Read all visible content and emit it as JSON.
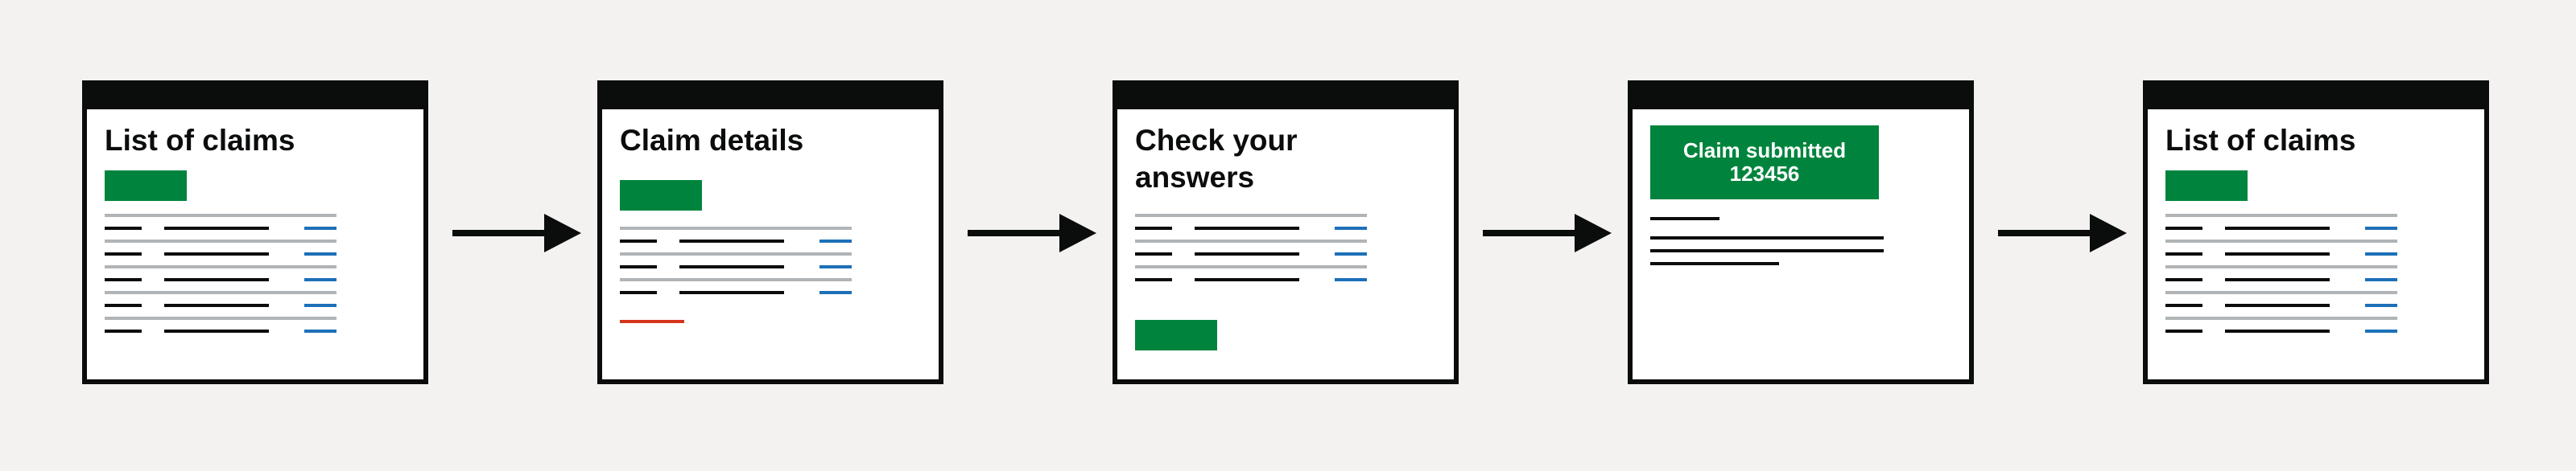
{
  "colors": {
    "background": "#f3f2f1",
    "frame": "#0b0c0c",
    "panel": "#ffffff",
    "button_green": "#00843d",
    "link_blue": "#1d70b8",
    "rule_grey": "#b1b4b6",
    "error_red": "#d4351c"
  },
  "steps": [
    {
      "title": "List of claims"
    },
    {
      "title": "Claim details"
    },
    {
      "title": "Check your answers"
    },
    {
      "banner_line1": "Claim submitted",
      "banner_line2": "123456"
    },
    {
      "title": "List of claims"
    }
  ]
}
